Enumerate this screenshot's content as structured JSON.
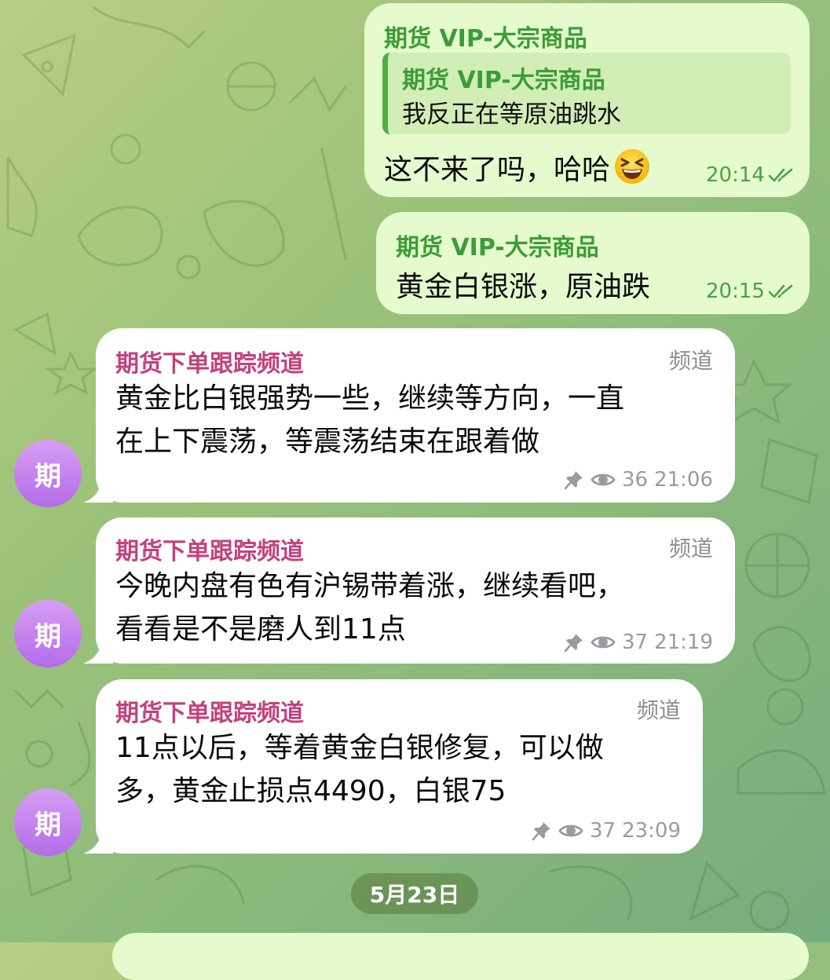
{
  "messages_out": [
    {
      "sender": "期货 VIP-大宗商品",
      "reply": {
        "sender": "期货 VIP-大宗商品",
        "text": "我反正在等原油跳水"
      },
      "text": "这不来了吗，哈哈",
      "emoji": "grinning-squinting-face",
      "time": "20:14",
      "status": "read"
    },
    {
      "sender": "期货 VIP-大宗商品",
      "text": "黄金白银涨，原油跌",
      "time": "20:15",
      "status": "read"
    }
  ],
  "messages_in": [
    {
      "sender": "期货下单跟踪频道",
      "tag": "频道",
      "lines": [
        "黄金比白银强势一些，继续等方向，一直",
        "在上下震荡，等震荡结束在跟着做"
      ],
      "views": "36",
      "time": "21:06",
      "avatar": "期"
    },
    {
      "sender": "期货下单跟踪频道",
      "tag": "频道",
      "lines": [
        "今晚内盘有色有沪锡带着涨，继续看吧，",
        "看看是不是磨人到11点"
      ],
      "views": "37",
      "time": "21:19",
      "avatar": "期"
    },
    {
      "sender": "期货下单跟踪频道",
      "tag": "频道",
      "lines": [
        "11点以后，等着黄金白银修复，可以做",
        "多，黄金止损点4490，白银75"
      ],
      "views": "37",
      "time": "23:09",
      "avatar": "期"
    }
  ],
  "date_separator": "5月23日",
  "colors": {
    "outgoing_bubble": "#e5fbcd",
    "incoming_bubble": "#ffffff",
    "outgoing_name": "#3d9c37",
    "channel_name": "#c2417e",
    "avatar_gradient": "#b36ce8"
  },
  "icons": {
    "read_status": "double-check-icon",
    "pinned": "pin-icon",
    "views": "eye-icon"
  }
}
